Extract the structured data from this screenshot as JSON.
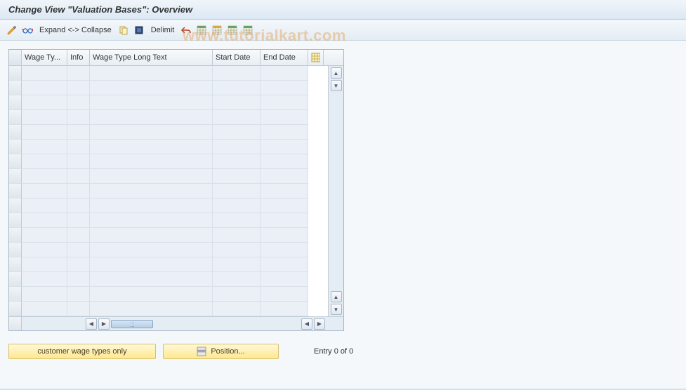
{
  "title": "Change View \"Valuation Bases\": Overview",
  "toolbar": {
    "expand_collapse": "Expand <-> Collapse",
    "delimit": "Delimit"
  },
  "table": {
    "columns": {
      "wage_type": "Wage Ty...",
      "info": "Info",
      "long_text": "Wage Type Long Text",
      "start_date": "Start Date",
      "end_date": "End Date"
    }
  },
  "buttons": {
    "customer_wage_types": "customer wage types only",
    "position": "Position..."
  },
  "status": {
    "entry_text": "Entry 0 of 0"
  },
  "watermark": "www.tutorialkart.com"
}
